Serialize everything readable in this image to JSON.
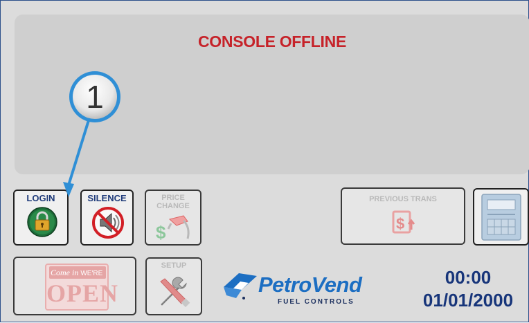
{
  "display": {
    "status": "CONSOLE OFFLINE"
  },
  "buttons": {
    "login": "LOGIN",
    "silence": "SILENCE",
    "price_change_line1": "PRICE",
    "price_change_line2": "CHANGE",
    "previous_trans": "PREVIOUS TRANS",
    "setup": "SETUP"
  },
  "open_sign": {
    "line1": "Come in",
    "line2": "WE'RE",
    "line3": "OPEN"
  },
  "logo": {
    "name": "PetroVend",
    "subtitle": "FUEL CONTROLS"
  },
  "clock": {
    "time": "00:00",
    "date": "01/01/2000"
  },
  "callout": {
    "number": "1"
  },
  "colors": {
    "status": "#c62229",
    "brand_blue": "#1c6ec2",
    "label_blue": "#1f3b7a",
    "callout_blue": "#2f8fd6"
  }
}
